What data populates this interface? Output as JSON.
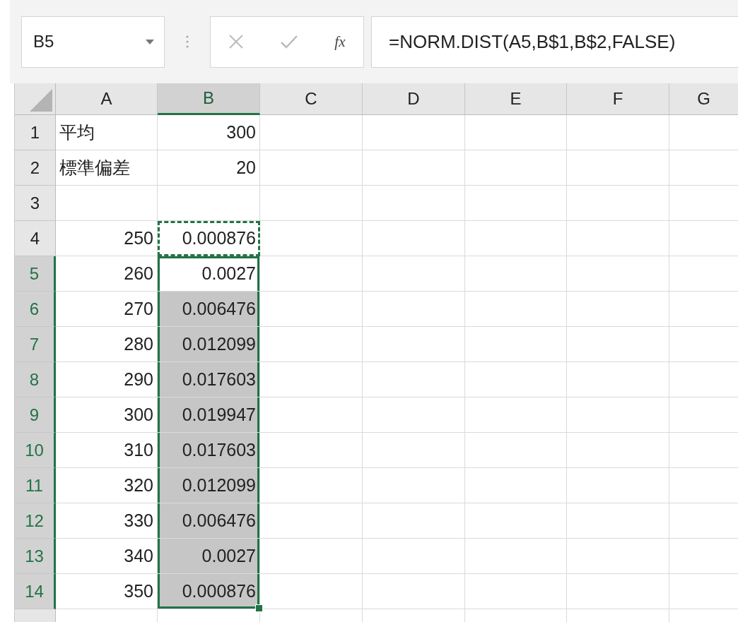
{
  "name_box": {
    "value": "B5"
  },
  "formula_bar": {
    "fx": "fx",
    "value": "=NORM.DIST(A5,B$1,B$2,FALSE)"
  },
  "columns": [
    {
      "label": "A",
      "selected": false
    },
    {
      "label": "B",
      "selected": true
    },
    {
      "label": "C",
      "selected": false
    },
    {
      "label": "D",
      "selected": false
    },
    {
      "label": "E",
      "selected": false
    },
    {
      "label": "F",
      "selected": false
    },
    {
      "label": "G",
      "selected": false
    }
  ],
  "rows": [
    {
      "header": "1",
      "selected": false,
      "cells": [
        {
          "text": "平均",
          "kind": "text",
          "selected": false,
          "active": false,
          "copied": false
        },
        {
          "text": "300",
          "kind": "number",
          "selected": false,
          "active": false,
          "copied": false
        }
      ]
    },
    {
      "header": "2",
      "selected": false,
      "cells": [
        {
          "text": "標準偏差",
          "kind": "text",
          "selected": false,
          "active": false,
          "copied": false
        },
        {
          "text": "20",
          "kind": "number",
          "selected": false,
          "active": false,
          "copied": false
        }
      ]
    },
    {
      "header": "3",
      "selected": false,
      "cells": []
    },
    {
      "header": "4",
      "selected": false,
      "cells": [
        {
          "text": "250",
          "kind": "number",
          "selected": false,
          "active": false,
          "copied": false
        },
        {
          "text": "0.000876",
          "kind": "number",
          "selected": false,
          "active": false,
          "copied": true
        }
      ]
    },
    {
      "header": "5",
      "selected": true,
      "cells": [
        {
          "text": "260",
          "kind": "number",
          "selected": false,
          "active": false,
          "copied": false
        },
        {
          "text": "0.0027",
          "kind": "number",
          "selected": true,
          "active": true,
          "copied": false
        }
      ]
    },
    {
      "header": "6",
      "selected": true,
      "cells": [
        {
          "text": "270",
          "kind": "number",
          "selected": false,
          "active": false,
          "copied": false
        },
        {
          "text": "0.006476",
          "kind": "number",
          "selected": true,
          "active": false,
          "copied": false
        }
      ]
    },
    {
      "header": "7",
      "selected": true,
      "cells": [
        {
          "text": "280",
          "kind": "number",
          "selected": false,
          "active": false,
          "copied": false
        },
        {
          "text": "0.012099",
          "kind": "number",
          "selected": true,
          "active": false,
          "copied": false
        }
      ]
    },
    {
      "header": "8",
      "selected": true,
      "cells": [
        {
          "text": "290",
          "kind": "number",
          "selected": false,
          "active": false,
          "copied": false
        },
        {
          "text": "0.017603",
          "kind": "number",
          "selected": true,
          "active": false,
          "copied": false
        }
      ]
    },
    {
      "header": "9",
      "selected": true,
      "cells": [
        {
          "text": "300",
          "kind": "number",
          "selected": false,
          "active": false,
          "copied": false
        },
        {
          "text": "0.019947",
          "kind": "number",
          "selected": true,
          "active": false,
          "copied": false
        }
      ]
    },
    {
      "header": "10",
      "selected": true,
      "cells": [
        {
          "text": "310",
          "kind": "number",
          "selected": false,
          "active": false,
          "copied": false
        },
        {
          "text": "0.017603",
          "kind": "number",
          "selected": true,
          "active": false,
          "copied": false
        }
      ]
    },
    {
      "header": "11",
      "selected": true,
      "cells": [
        {
          "text": "320",
          "kind": "number",
          "selected": false,
          "active": false,
          "copied": false
        },
        {
          "text": "0.012099",
          "kind": "number",
          "selected": true,
          "active": false,
          "copied": false
        }
      ]
    },
    {
      "header": "12",
      "selected": true,
      "cells": [
        {
          "text": "330",
          "kind": "number",
          "selected": false,
          "active": false,
          "copied": false
        },
        {
          "text": "0.006476",
          "kind": "number",
          "selected": true,
          "active": false,
          "copied": false
        }
      ]
    },
    {
      "header": "13",
      "selected": true,
      "cells": [
        {
          "text": "340",
          "kind": "number",
          "selected": false,
          "active": false,
          "copied": false
        },
        {
          "text": "0.0027",
          "kind": "number",
          "selected": true,
          "active": false,
          "copied": false
        }
      ]
    },
    {
      "header": "14",
      "selected": true,
      "cells": [
        {
          "text": "350",
          "kind": "number",
          "selected": false,
          "active": false,
          "copied": false
        },
        {
          "text": "0.000876",
          "kind": "number",
          "selected": true,
          "active": false,
          "copied": false
        }
      ]
    }
  ]
}
